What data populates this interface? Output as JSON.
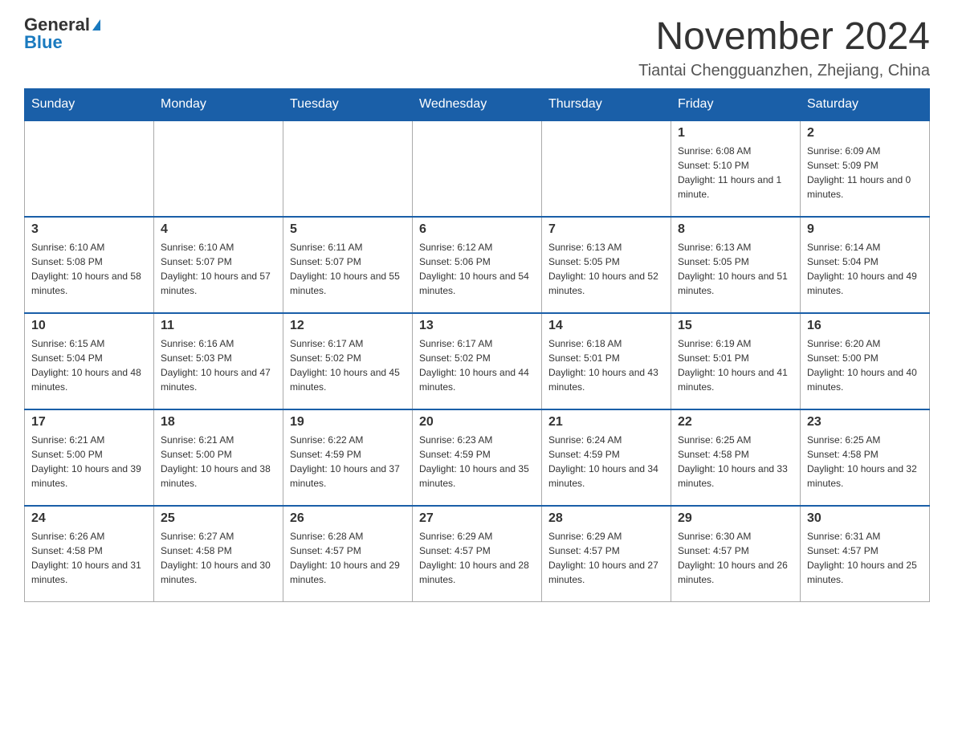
{
  "header": {
    "logo_general": "General",
    "logo_blue": "Blue",
    "month_title": "November 2024",
    "location": "Tiantai Chengguanzhen, Zhejiang, China"
  },
  "weekdays": [
    "Sunday",
    "Monday",
    "Tuesday",
    "Wednesday",
    "Thursday",
    "Friday",
    "Saturday"
  ],
  "weeks": [
    [
      {
        "day": "",
        "sunrise": "",
        "sunset": "",
        "daylight": ""
      },
      {
        "day": "",
        "sunrise": "",
        "sunset": "",
        "daylight": ""
      },
      {
        "day": "",
        "sunrise": "",
        "sunset": "",
        "daylight": ""
      },
      {
        "day": "",
        "sunrise": "",
        "sunset": "",
        "daylight": ""
      },
      {
        "day": "",
        "sunrise": "",
        "sunset": "",
        "daylight": ""
      },
      {
        "day": "1",
        "sunrise": "Sunrise: 6:08 AM",
        "sunset": "Sunset: 5:10 PM",
        "daylight": "Daylight: 11 hours and 1 minute."
      },
      {
        "day": "2",
        "sunrise": "Sunrise: 6:09 AM",
        "sunset": "Sunset: 5:09 PM",
        "daylight": "Daylight: 11 hours and 0 minutes."
      }
    ],
    [
      {
        "day": "3",
        "sunrise": "Sunrise: 6:10 AM",
        "sunset": "Sunset: 5:08 PM",
        "daylight": "Daylight: 10 hours and 58 minutes."
      },
      {
        "day": "4",
        "sunrise": "Sunrise: 6:10 AM",
        "sunset": "Sunset: 5:07 PM",
        "daylight": "Daylight: 10 hours and 57 minutes."
      },
      {
        "day": "5",
        "sunrise": "Sunrise: 6:11 AM",
        "sunset": "Sunset: 5:07 PM",
        "daylight": "Daylight: 10 hours and 55 minutes."
      },
      {
        "day": "6",
        "sunrise": "Sunrise: 6:12 AM",
        "sunset": "Sunset: 5:06 PM",
        "daylight": "Daylight: 10 hours and 54 minutes."
      },
      {
        "day": "7",
        "sunrise": "Sunrise: 6:13 AM",
        "sunset": "Sunset: 5:05 PM",
        "daylight": "Daylight: 10 hours and 52 minutes."
      },
      {
        "day": "8",
        "sunrise": "Sunrise: 6:13 AM",
        "sunset": "Sunset: 5:05 PM",
        "daylight": "Daylight: 10 hours and 51 minutes."
      },
      {
        "day": "9",
        "sunrise": "Sunrise: 6:14 AM",
        "sunset": "Sunset: 5:04 PM",
        "daylight": "Daylight: 10 hours and 49 minutes."
      }
    ],
    [
      {
        "day": "10",
        "sunrise": "Sunrise: 6:15 AM",
        "sunset": "Sunset: 5:04 PM",
        "daylight": "Daylight: 10 hours and 48 minutes."
      },
      {
        "day": "11",
        "sunrise": "Sunrise: 6:16 AM",
        "sunset": "Sunset: 5:03 PM",
        "daylight": "Daylight: 10 hours and 47 minutes."
      },
      {
        "day": "12",
        "sunrise": "Sunrise: 6:17 AM",
        "sunset": "Sunset: 5:02 PM",
        "daylight": "Daylight: 10 hours and 45 minutes."
      },
      {
        "day": "13",
        "sunrise": "Sunrise: 6:17 AM",
        "sunset": "Sunset: 5:02 PM",
        "daylight": "Daylight: 10 hours and 44 minutes."
      },
      {
        "day": "14",
        "sunrise": "Sunrise: 6:18 AM",
        "sunset": "Sunset: 5:01 PM",
        "daylight": "Daylight: 10 hours and 43 minutes."
      },
      {
        "day": "15",
        "sunrise": "Sunrise: 6:19 AM",
        "sunset": "Sunset: 5:01 PM",
        "daylight": "Daylight: 10 hours and 41 minutes."
      },
      {
        "day": "16",
        "sunrise": "Sunrise: 6:20 AM",
        "sunset": "Sunset: 5:00 PM",
        "daylight": "Daylight: 10 hours and 40 minutes."
      }
    ],
    [
      {
        "day": "17",
        "sunrise": "Sunrise: 6:21 AM",
        "sunset": "Sunset: 5:00 PM",
        "daylight": "Daylight: 10 hours and 39 minutes."
      },
      {
        "day": "18",
        "sunrise": "Sunrise: 6:21 AM",
        "sunset": "Sunset: 5:00 PM",
        "daylight": "Daylight: 10 hours and 38 minutes."
      },
      {
        "day": "19",
        "sunrise": "Sunrise: 6:22 AM",
        "sunset": "Sunset: 4:59 PM",
        "daylight": "Daylight: 10 hours and 37 minutes."
      },
      {
        "day": "20",
        "sunrise": "Sunrise: 6:23 AM",
        "sunset": "Sunset: 4:59 PM",
        "daylight": "Daylight: 10 hours and 35 minutes."
      },
      {
        "day": "21",
        "sunrise": "Sunrise: 6:24 AM",
        "sunset": "Sunset: 4:59 PM",
        "daylight": "Daylight: 10 hours and 34 minutes."
      },
      {
        "day": "22",
        "sunrise": "Sunrise: 6:25 AM",
        "sunset": "Sunset: 4:58 PM",
        "daylight": "Daylight: 10 hours and 33 minutes."
      },
      {
        "day": "23",
        "sunrise": "Sunrise: 6:25 AM",
        "sunset": "Sunset: 4:58 PM",
        "daylight": "Daylight: 10 hours and 32 minutes."
      }
    ],
    [
      {
        "day": "24",
        "sunrise": "Sunrise: 6:26 AM",
        "sunset": "Sunset: 4:58 PM",
        "daylight": "Daylight: 10 hours and 31 minutes."
      },
      {
        "day": "25",
        "sunrise": "Sunrise: 6:27 AM",
        "sunset": "Sunset: 4:58 PM",
        "daylight": "Daylight: 10 hours and 30 minutes."
      },
      {
        "day": "26",
        "sunrise": "Sunrise: 6:28 AM",
        "sunset": "Sunset: 4:57 PM",
        "daylight": "Daylight: 10 hours and 29 minutes."
      },
      {
        "day": "27",
        "sunrise": "Sunrise: 6:29 AM",
        "sunset": "Sunset: 4:57 PM",
        "daylight": "Daylight: 10 hours and 28 minutes."
      },
      {
        "day": "28",
        "sunrise": "Sunrise: 6:29 AM",
        "sunset": "Sunset: 4:57 PM",
        "daylight": "Daylight: 10 hours and 27 minutes."
      },
      {
        "day": "29",
        "sunrise": "Sunrise: 6:30 AM",
        "sunset": "Sunset: 4:57 PM",
        "daylight": "Daylight: 10 hours and 26 minutes."
      },
      {
        "day": "30",
        "sunrise": "Sunrise: 6:31 AM",
        "sunset": "Sunset: 4:57 PM",
        "daylight": "Daylight: 10 hours and 25 minutes."
      }
    ]
  ]
}
